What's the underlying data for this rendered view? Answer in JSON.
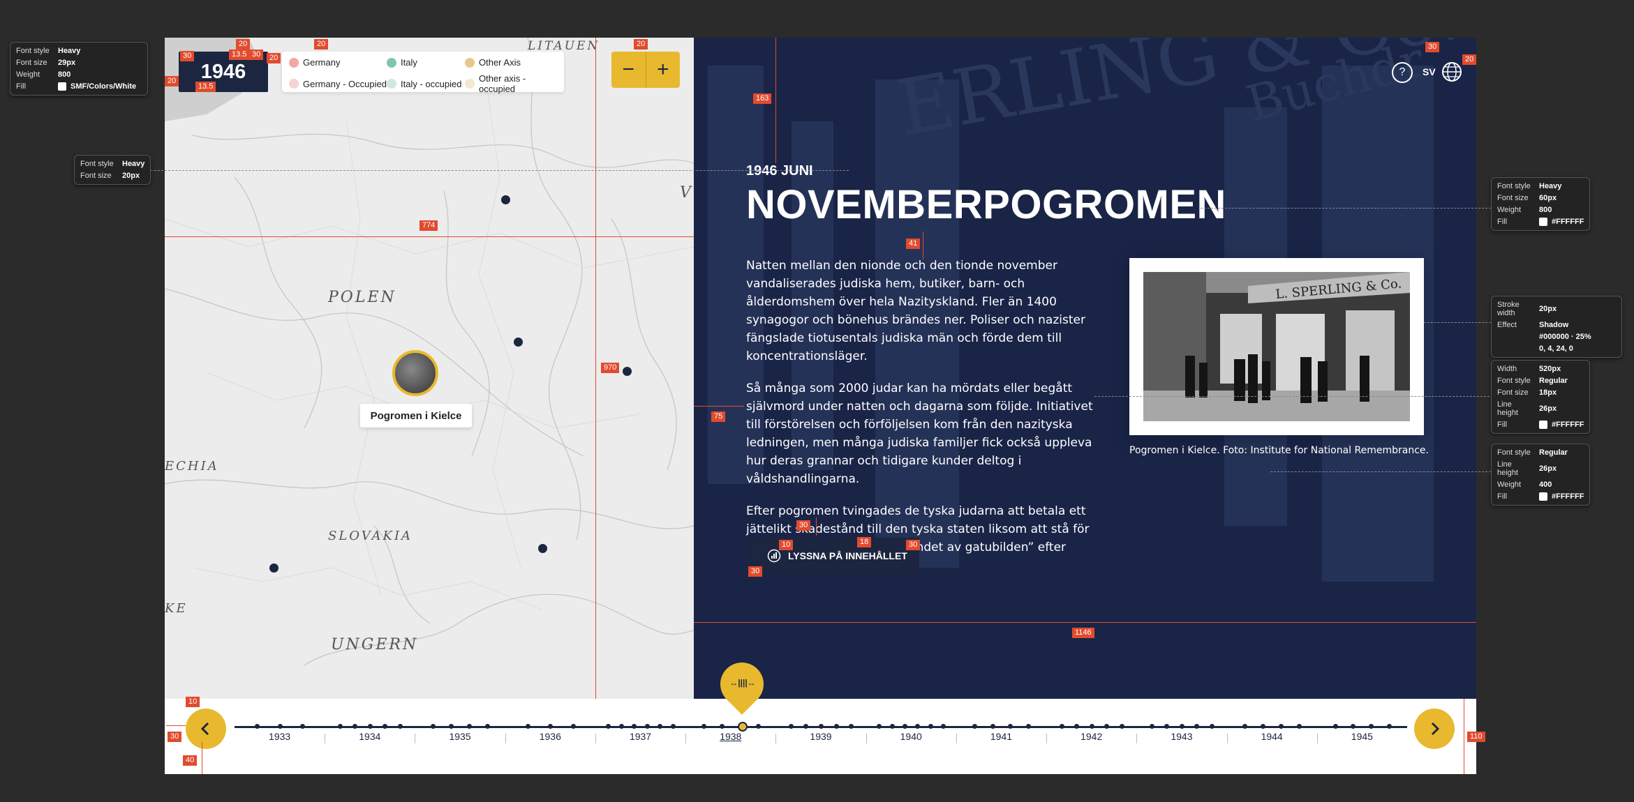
{
  "map": {
    "year": "1946",
    "legend": [
      {
        "label": "Germany",
        "color": "#f2a6a6"
      },
      {
        "label": "Italy",
        "color": "#7fc7a8"
      },
      {
        "label": "Other Axis",
        "color": "#e6c98a"
      },
      {
        "label": "Germany - Occupied",
        "color": "#f7d3d3"
      },
      {
        "label": "Italy - occupied",
        "color": "#cfe9dc"
      },
      {
        "label": "Other axis - occupied",
        "color": "#f2e8cf"
      }
    ],
    "countries": [
      "LITAUEN",
      "POLEN",
      "SLOVAKIA",
      "UNGERN",
      "ECHIA",
      "KE",
      "V"
    ],
    "event_label": "Pogromen i Kielce",
    "zoom_out": "−",
    "zoom_in": "+"
  },
  "header": {
    "help": "?",
    "language": "SV"
  },
  "article": {
    "date": "1946 JUNI",
    "title": "NOVEMBERPOGROMEN",
    "paragraphs": [
      "Natten mellan den nionde och den tionde november vandaliserades judiska hem, butiker, barn- och ålderdomshem över hela Nazityskland. Fler än 1400 synagogor och bönehus brändes ner. Poliser och nazister fängslade tiotusentals judiska män och förde dem till koncentrationsläger.",
      "Så många som 2000 judar kan ha mördats eller begått självmord under natten och dagarna som följde. Initiativet till förstörelsen och förföljelsen kom från den nazityska ledningen, men många judiska familjer fick också uppleva hur deras grannar och tidigare kunder deltog i våldshandlingarna.",
      "Efter pogromen tvingades de tyska judarna att betala ett jättelikt skadestånd till den tyska staten liksom att stå för alla kostnader för ”återställandet av gatubilden” efter förstörelsen."
    ],
    "listen_button": "LYSSNA PÅ INNEHÅLLET",
    "photo_caption": "Pogromen i Kielce. Foto: Institute for National Remembrance.",
    "photo_sign": "L. SPERLING & Co."
  },
  "timeline": {
    "years": [
      "1933",
      "1934",
      "1935",
      "1936",
      "1937",
      "1938",
      "1939",
      "1940",
      "1941",
      "1942",
      "1943",
      "1944",
      "1945"
    ],
    "selected_year": "1938",
    "handle_label": "↔||||↔",
    "prev_label": "‹",
    "next_label": "›"
  },
  "redlines": {
    "tags": [
      "30",
      "20",
      "13.5",
      "30",
      "20",
      "20",
      "20",
      "13.5",
      "20",
      "163",
      "774",
      "41",
      "970",
      "75",
      "30",
      "10",
      "18",
      "30",
      "30",
      "1146",
      "10",
      "30",
      "40",
      "110",
      "30",
      "20"
    ]
  },
  "specs": [
    {
      "rows": [
        [
          "Font style",
          "Heavy"
        ],
        [
          "Font size",
          "29px"
        ],
        [
          "Weight",
          "800"
        ],
        [
          "Fill",
          "SMF/Colors/White"
        ]
      ]
    },
    {
      "rows": [
        [
          "Font style",
          "Heavy"
        ],
        [
          "Font size",
          "20px"
        ]
      ]
    },
    {
      "rows": [
        [
          "Font style",
          "Heavy"
        ],
        [
          "Font size",
          "60px"
        ],
        [
          "Weight",
          "800"
        ],
        [
          "Fill",
          "#FFFFFF"
        ]
      ]
    },
    {
      "rows": [
        [
          "Stroke width",
          "20px"
        ],
        [
          "Effect",
          "Shadow"
        ],
        [
          "",
          "#000000 · 25%"
        ],
        [
          "",
          "0, 4, 24, 0"
        ]
      ]
    },
    {
      "rows": [
        [
          "Width",
          "520px"
        ],
        [
          "Font style",
          "Regular"
        ],
        [
          "Font size",
          "18px"
        ],
        [
          "Line height",
          "26px"
        ],
        [
          "Fill",
          "#FFFFFF"
        ]
      ]
    },
    {
      "rows": [
        [
          "Font style",
          "Regular"
        ],
        [
          "Line height",
          "26px"
        ],
        [
          "Weight",
          "400"
        ],
        [
          "Fill",
          "#FFFFFF"
        ]
      ]
    }
  ],
  "colors": {
    "accent": "#e8b92f",
    "navy": "#1c2640",
    "redline": "#e14b2e"
  }
}
